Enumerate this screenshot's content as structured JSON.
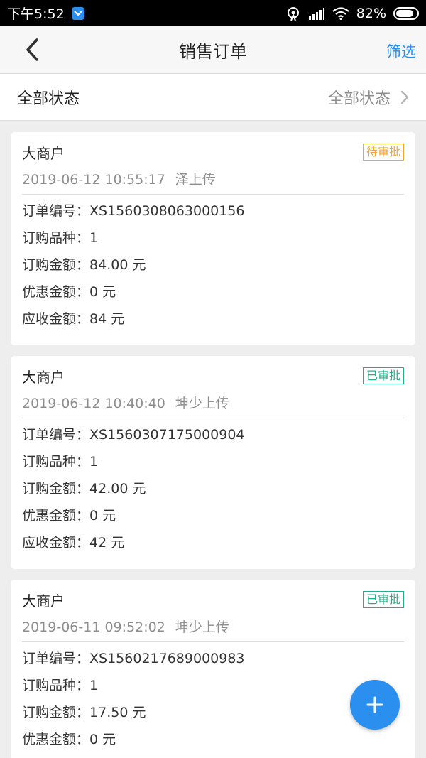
{
  "status_bar": {
    "time": "下午5:52",
    "battery": "82%"
  },
  "nav": {
    "title": "销售订单",
    "filter_label": "筛选"
  },
  "filter_row": {
    "label": "全部状态",
    "value": "全部状态"
  },
  "labels": {
    "order_no": "订单编号：",
    "variety": "订购品种：",
    "amount": "订购金额：",
    "discount": "优惠金额：",
    "receivable": "应收金额："
  },
  "orders": [
    {
      "merchant": "大商户",
      "status": "待审批",
      "datetime": "2019-06-12 10:55:17",
      "uploader": "泽上传",
      "order_no": "XS1560308063000156",
      "variety": "1",
      "amount": "84.00 元",
      "discount": "0 元",
      "receivable": "84 元"
    },
    {
      "merchant": "大商户",
      "status": "已审批",
      "datetime": "2019-06-12 10:40:40",
      "uploader": "坤少上传",
      "order_no": "XS1560307175000904",
      "variety": "1",
      "amount": "42.00 元",
      "discount": "0 元",
      "receivable": "42 元"
    },
    {
      "merchant": "大商户",
      "status": "已审批",
      "datetime": "2019-06-11 09:52:02",
      "uploader": "坤少上传",
      "order_no": "XS1560217689000983",
      "variety": "1",
      "amount": "17.50 元",
      "discount": "0 元"
    }
  ],
  "colors": {
    "accent": "#2b8ff0",
    "pending": "#f5a623",
    "approved": "#1fb28a"
  },
  "icons": {
    "back": "chevron-left-icon",
    "filter_arrow": "chevron-right-icon",
    "fab": "plus-icon"
  }
}
